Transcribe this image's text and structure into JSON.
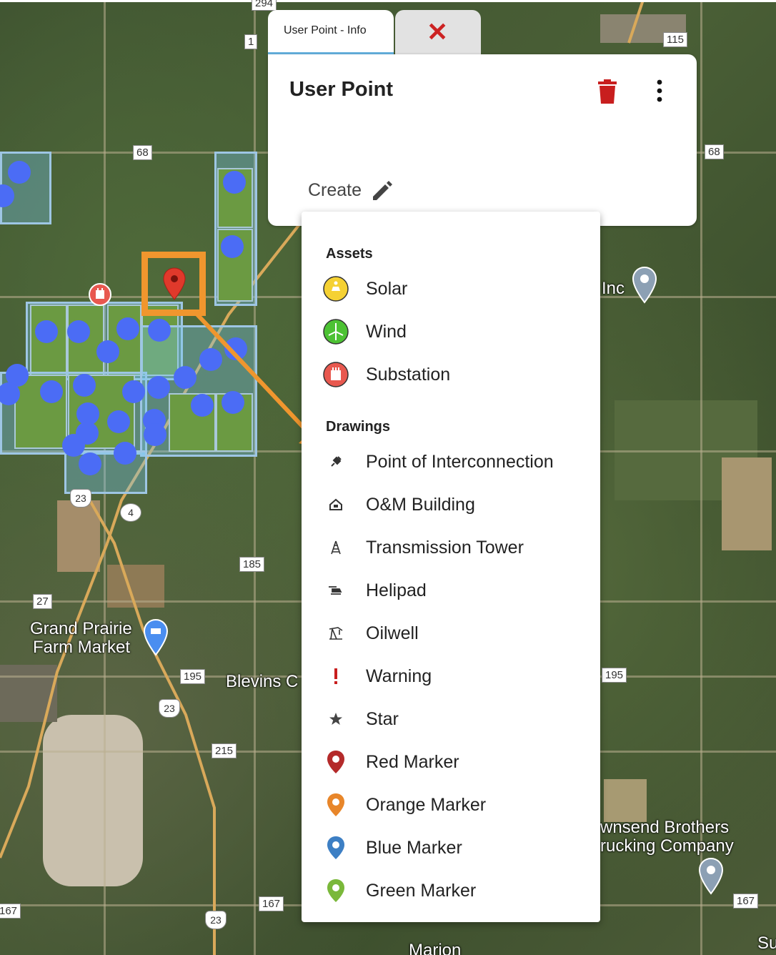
{
  "map": {
    "labels": {
      "grand_prairie_1": "Grand Prairie",
      "grand_prairie_2": "Farm Market",
      "blevins": "Blevins C",
      "inc": "Inc",
      "townsend_1": "wnsend Brothers",
      "townsend_2": "rucking Company",
      "marion": "Marion",
      "su": "Su"
    },
    "route_shields": [
      "1",
      "68",
      "68",
      "115",
      "294",
      "4",
      "23",
      "23",
      "23",
      "185",
      "27",
      "195",
      "195",
      "215",
      "167",
      "167",
      "167"
    ]
  },
  "tabs": {
    "info_label": "User Point - Info",
    "close_label": "✕"
  },
  "panel": {
    "title": "User Point",
    "create_label": "Create"
  },
  "menu": {
    "assets_header": "Assets",
    "drawings_header": "Drawings",
    "assets": [
      {
        "label": "Solar",
        "icon": "solar-icon",
        "color": "#f5d133"
      },
      {
        "label": "Wind",
        "icon": "wind-icon",
        "color": "#4cc233"
      },
      {
        "label": "Substation",
        "icon": "substation-icon",
        "color": "#e8584f"
      }
    ],
    "drawings": [
      {
        "label": "Point of Interconnection",
        "icon": "plug-icon"
      },
      {
        "label": "O&M Building",
        "icon": "building-icon"
      },
      {
        "label": "Transmission Tower",
        "icon": "tower-icon"
      },
      {
        "label": "Helipad",
        "icon": "helicopter-icon"
      },
      {
        "label": "Oilwell",
        "icon": "oilwell-icon"
      },
      {
        "label": "Warning",
        "icon": "warning-icon",
        "color": "#c81e1e"
      },
      {
        "label": "Star",
        "icon": "star-icon"
      },
      {
        "label": "Red Marker",
        "icon": "red-marker-icon",
        "color": "#b42a2a"
      },
      {
        "label": "Orange Marker",
        "icon": "orange-marker-icon",
        "color": "#e8862a"
      },
      {
        "label": "Blue Marker",
        "icon": "blue-marker-icon",
        "color": "#3d7fc4"
      },
      {
        "label": "Green Marker",
        "icon": "green-marker-icon",
        "color": "#7ab83a"
      }
    ]
  },
  "colors": {
    "highlight": "#f0962e",
    "site_dot": "#4b6cf5",
    "delete": "#c81e1e"
  }
}
